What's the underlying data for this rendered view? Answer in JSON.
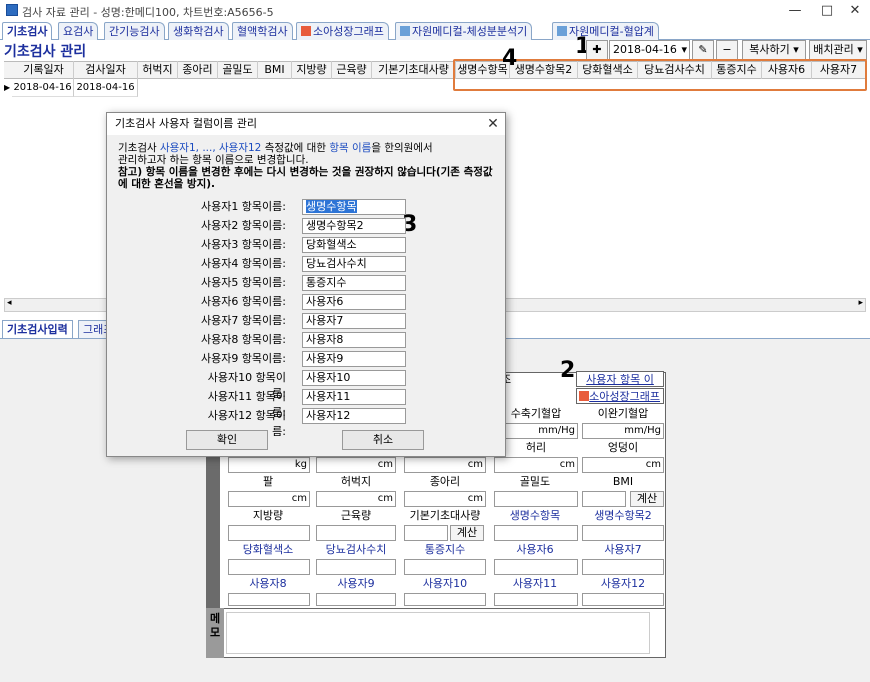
{
  "window": {
    "title": "검사 자료 관리 - 성명:한메디100, 차트번호:A5656-5",
    "minimize": "—",
    "maximize": "□",
    "close": "✕"
  },
  "tabs": [
    {
      "label": "기초검사",
      "active": true
    },
    {
      "label": "요검사"
    },
    {
      "label": "간기능검사"
    },
    {
      "label": "생화학검사"
    },
    {
      "label": "혈액학검사"
    },
    {
      "label": "소아성장그래프"
    },
    {
      "label": "자원메디컬-체성분분석기"
    },
    {
      "label": "자원메디컬-혈압계"
    }
  ],
  "header": {
    "title": "기초검사 관리",
    "date": "2018-04-16",
    "copy_button": "복사하기 ▾",
    "batch_button": "배치관리 ▾"
  },
  "grid": {
    "columns": [
      "기록일자",
      "검사일자",
      "허벅지",
      "종아리",
      "골밀도",
      "BMI",
      "지방량",
      "근육량",
      "기본기초대사량",
      "생명수항목",
      "생명수항목2",
      "당화혈색소",
      "당뇨검사수치",
      "통증지수",
      "사용자6",
      "사용자7"
    ],
    "rows": [
      [
        "2018-04-16",
        "2018-04-16"
      ]
    ]
  },
  "annotations": {
    "n1": "1",
    "n2": "2",
    "n3": "3",
    "n4": "4"
  },
  "subtabs": [
    {
      "label": "기초검사입력",
      "active": true
    },
    {
      "label": "그래프"
    }
  ],
  "form": {
    "top_right_partial": "조",
    "user_item_link": "사용자 항목 이름...",
    "growth_graph_link": "소아성장그래프",
    "row1_labels": [
      "수축기혈압",
      "이완기혈압"
    ],
    "unit_mmhg": "mm/Hg",
    "row2_labels": [
      "허리",
      "엉덩이"
    ],
    "unit_kg": "kg",
    "unit_cm": "cm",
    "row3_labels": [
      "팔",
      "허벅지",
      "종아리",
      "골밀도",
      "BMI"
    ],
    "calc": "계산",
    "row4_labels": [
      "지방량",
      "근육량",
      "기본기초대사량",
      "생명수항목",
      "생명수항목2"
    ],
    "row5_labels": [
      "당화혈색소",
      "당뇨검사수치",
      "통증지수",
      "사용자6",
      "사용자7"
    ],
    "row6_labels": [
      "사용자8",
      "사용자9",
      "사용자10",
      "사용자11",
      "사용자12"
    ],
    "memo_label": "메모"
  },
  "dialog": {
    "title": "기초검사 사용자 컬럼이름 관리",
    "close": "✕",
    "info_part1": "기초검사 ",
    "info_hl1": "사용자1, ..., 사용자12",
    "info_part2": " 측정값에 대한 ",
    "info_hl2": "항목 이름",
    "info_part3": "을 한의원에서",
    "info_line2": "관리하고자 하는 항목 이름으로 변경합니다.",
    "info_bold": "참고) 항목 이름을 변경한 후에는 다시 변경하는 것을 권장하지 않습니다(기존 측정값에 대한 혼선을 방지).",
    "fields": [
      {
        "label": "사용자1 항목이름:",
        "value": "생명수항목"
      },
      {
        "label": "사용자2 항목이름:",
        "value": "생명수항목2"
      },
      {
        "label": "사용자3 항목이름:",
        "value": "당화혈색소"
      },
      {
        "label": "사용자4 항목이름:",
        "value": "당뇨검사수치"
      },
      {
        "label": "사용자5 항목이름:",
        "value": "통증지수"
      },
      {
        "label": "사용자6 항목이름:",
        "value": "사용자6"
      },
      {
        "label": "사용자7 항목이름:",
        "value": "사용자7"
      },
      {
        "label": "사용자8 항목이름:",
        "value": "사용자8"
      },
      {
        "label": "사용자9 항목이름:",
        "value": "사용자9"
      },
      {
        "label": "사용자10 항목이름:",
        "value": "사용자10"
      },
      {
        "label": "사용자11 항목이름:",
        "value": "사용자11"
      },
      {
        "label": "사용자12 항목이름:",
        "value": "사용자12"
      }
    ],
    "ok": "확인",
    "cancel": "취소"
  }
}
